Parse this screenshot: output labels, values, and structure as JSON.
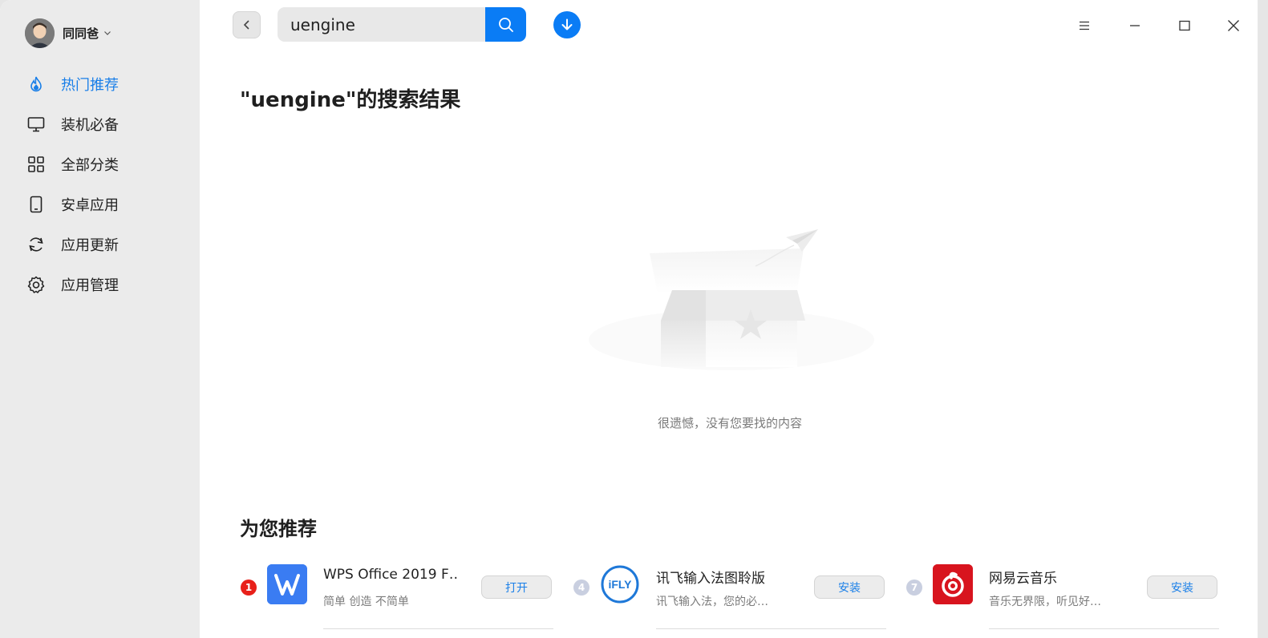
{
  "user": {
    "name": "同同爸"
  },
  "sidebar": {
    "items": [
      {
        "label": "热门推荐",
        "icon": "flame-icon",
        "active": true
      },
      {
        "label": "装机必备",
        "icon": "monitor-icon",
        "active": false
      },
      {
        "label": "全部分类",
        "icon": "grid-icon",
        "active": false
      },
      {
        "label": "安卓应用",
        "icon": "phone-icon",
        "active": false
      },
      {
        "label": "应用更新",
        "icon": "refresh-icon",
        "active": false
      },
      {
        "label": "应用管理",
        "icon": "gear-icon",
        "active": false
      }
    ]
  },
  "search": {
    "value": "uengine",
    "placeholder": ""
  },
  "main": {
    "results_title": "\"uengine\"的搜索结果",
    "empty_text": "很遗憾，没有您要找的内容",
    "recommend_title": "为您推荐"
  },
  "recommendations": [
    {
      "rank": "1",
      "name": "WPS Office 2019 F…",
      "desc": "简单 创造 不简单",
      "action": "打开",
      "icon": "wps-icon",
      "rank_color": "#e8201a"
    },
    {
      "rank": "4",
      "name": "讯飞输入法图聆版",
      "desc": "讯飞输入法，您的必…",
      "action": "安装",
      "icon": "ifly-icon",
      "rank_color": "#c9cfe0"
    },
    {
      "rank": "7",
      "name": "网易云音乐",
      "desc": "音乐无界限，听见好…",
      "action": "安装",
      "icon": "netease-music-icon",
      "rank_color": "#c9cfe0"
    }
  ],
  "colors": {
    "accent": "#0a7cf5",
    "active_nav": "#1a7fe8",
    "sidebar_bg": "#ebebeb"
  }
}
